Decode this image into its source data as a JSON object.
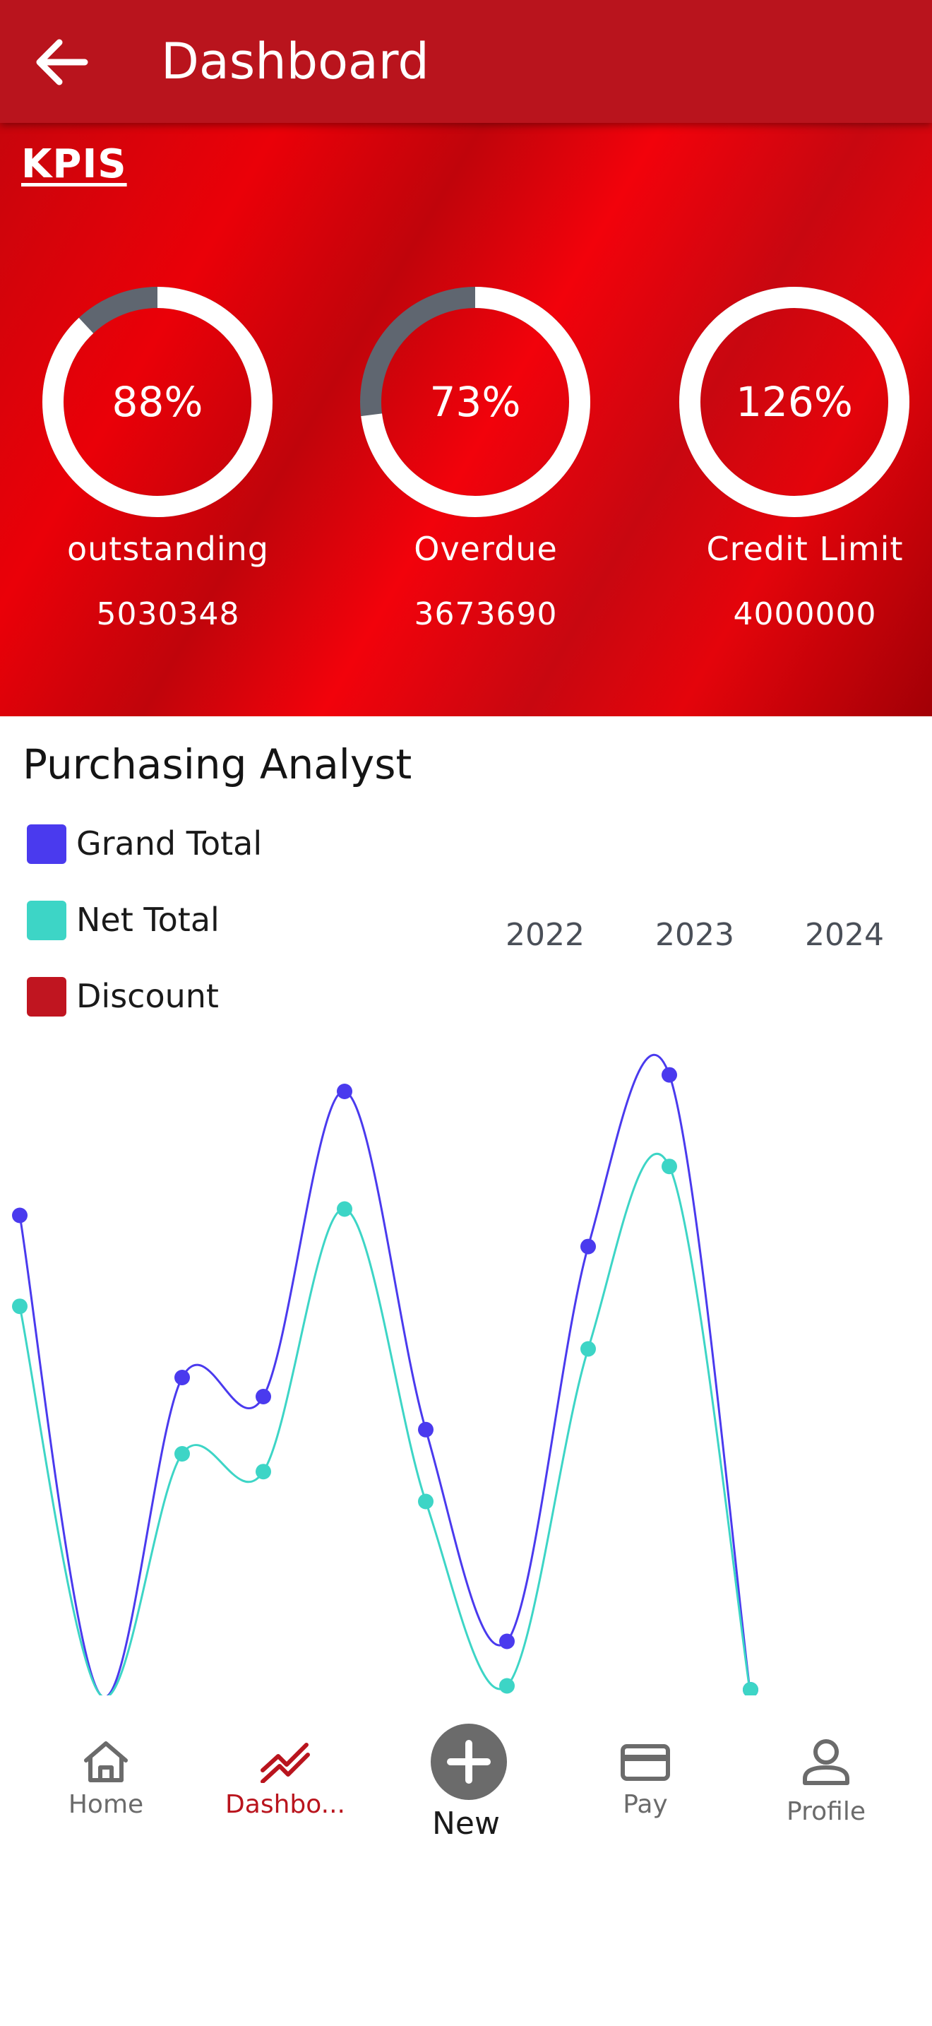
{
  "appbar": {
    "title": "Dashboard"
  },
  "kpi": {
    "heading": "KPIS",
    "items": [
      {
        "percent_label": "88%",
        "label": "outstanding",
        "value": "5030348",
        "fill_fraction": 0.88
      },
      {
        "percent_label": "73%",
        "label": "Overdue",
        "value": "3673690",
        "fill_fraction": 0.73
      },
      {
        "percent_label": "126%",
        "label": "Credit Limit",
        "value": "4000000",
        "fill_fraction": 1.0
      }
    ],
    "colors": {
      "ring_fill": "#ffffff",
      "ring_track": "#5f6670"
    }
  },
  "chart": {
    "title": "Purchasing Analyst",
    "legend": [
      {
        "name": "Grand Total",
        "color": "#4a3aee"
      },
      {
        "name": "Net Total",
        "color": "#3dd5c6"
      },
      {
        "name": "Discount",
        "color": "#c01520"
      }
    ],
    "years": [
      "2022",
      "2023",
      "2024"
    ]
  },
  "chart_data": {
    "type": "line",
    "title": "Purchasing Analyst",
    "x_tick_labels": [
      "2022",
      "2023",
      "2024"
    ],
    "point_count": 10,
    "series": [
      {
        "name": "Grand Total",
        "color": "#4a3aee",
        "values": [
          0.755,
          0.0,
          0.5,
          0.47,
          0.95,
          0.418,
          0.085,
          0.706,
          0.976,
          0.0
        ]
      },
      {
        "name": "Net Total",
        "color": "#3dd5c6",
        "values": [
          0.612,
          0.0,
          0.38,
          0.352,
          0.765,
          0.305,
          0.015,
          0.545,
          0.832,
          0.0
        ]
      },
      {
        "name": "Discount",
        "color": "#c01520",
        "values": []
      }
    ]
  },
  "bottom_nav": {
    "items": [
      {
        "label": "Home",
        "icon": "home-icon"
      },
      {
        "label": "Dashbo...",
        "icon": "trending-up-icon",
        "active": true
      },
      {
        "label": "New",
        "icon": "add-circle-icon"
      },
      {
        "label": "Pay",
        "icon": "credit-card-icon"
      },
      {
        "label": "Profile",
        "icon": "user-icon"
      }
    ],
    "active_color": "#b9141d",
    "inactive_color": "#6b6b6b"
  }
}
